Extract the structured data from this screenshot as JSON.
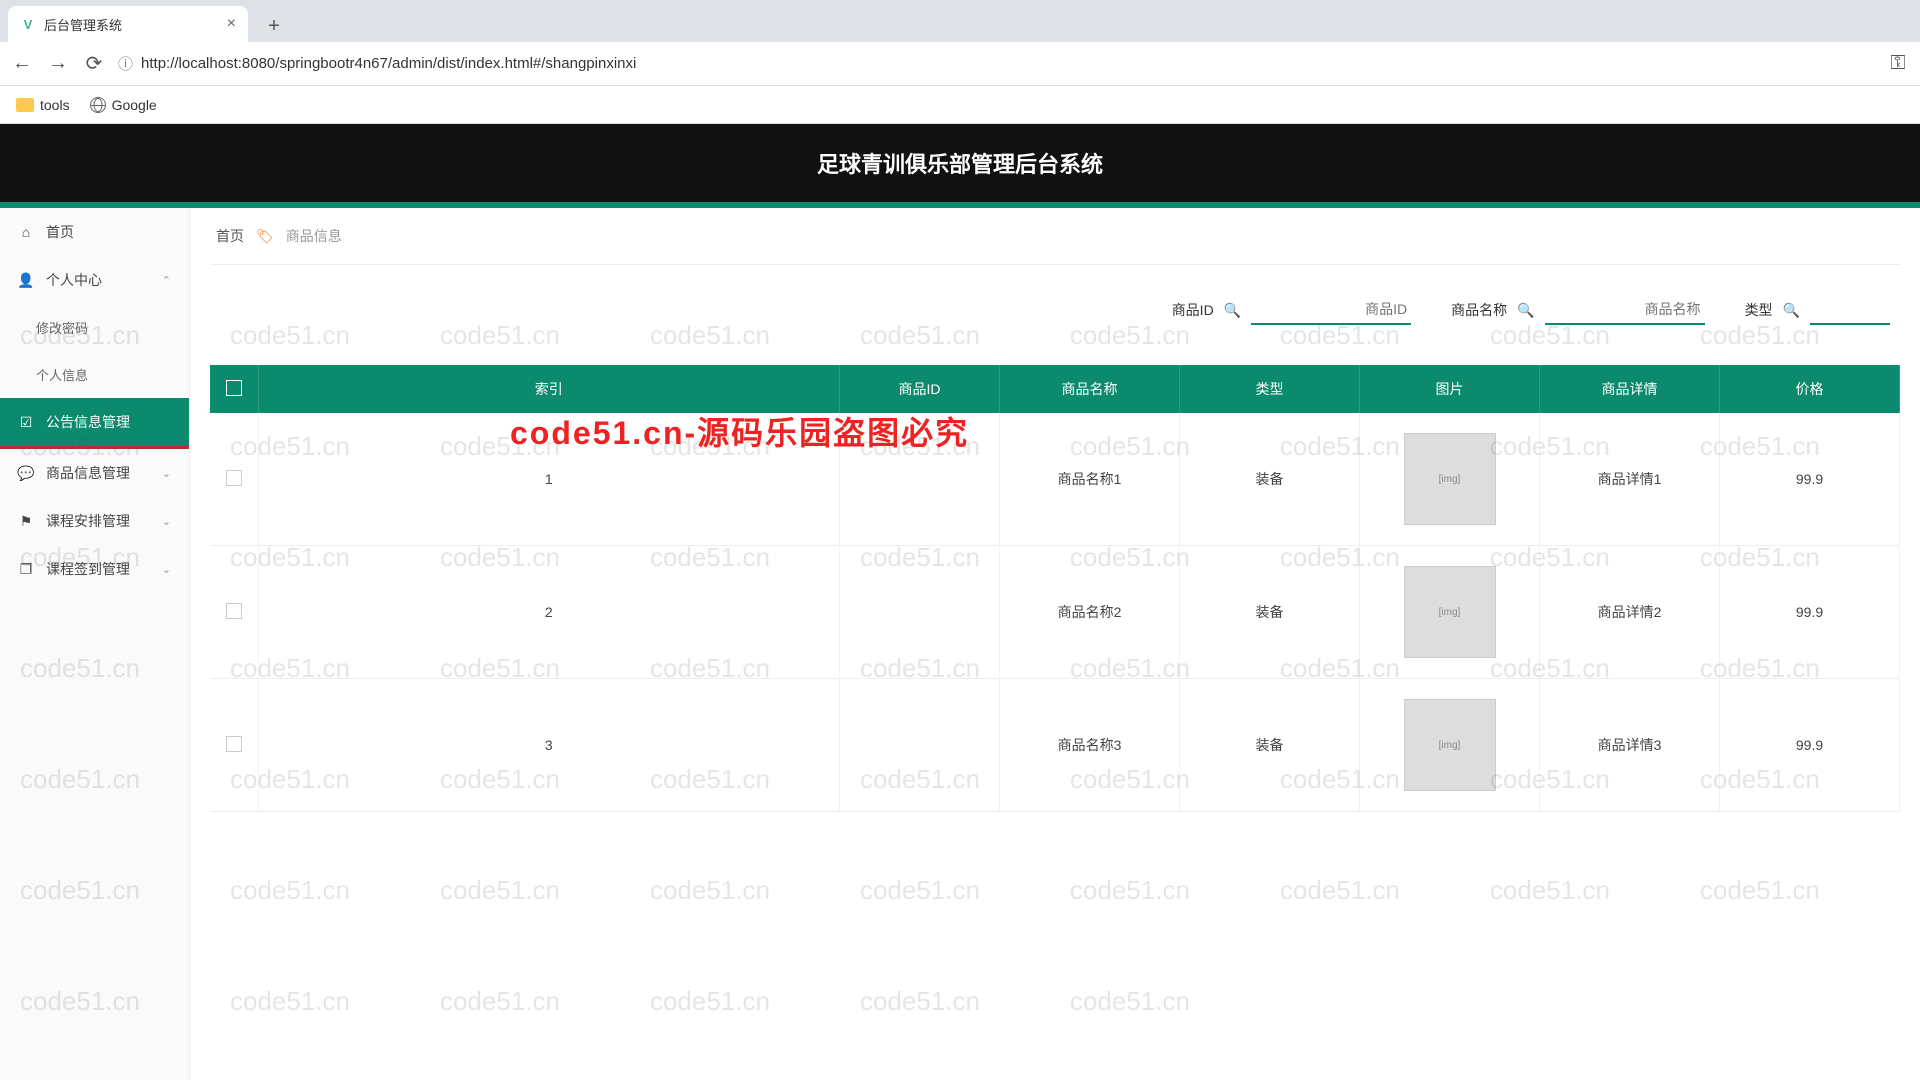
{
  "browser": {
    "tab_title": "后台管理系统",
    "new_tab": "+",
    "close_tab": "×",
    "url": "http://localhost:8080/springbootr4n67/admin/dist/index.html#/shangpinxinxi",
    "bookmarks": {
      "tools": "tools",
      "google": "Google"
    }
  },
  "app": {
    "title": "足球青训俱乐部管理后台系统"
  },
  "sidebar": {
    "home": "首页",
    "personal": "个人中心",
    "change_pw": "修改密码",
    "profile": "个人信息",
    "announce": "公告信息管理",
    "goods": "商品信息管理",
    "schedule": "课程安排管理",
    "signin": "课程签到管理"
  },
  "breadcrumb": {
    "home": "首页",
    "current": "商品信息"
  },
  "filters": {
    "id_label": "商品ID",
    "id_ph": "商品ID",
    "name_label": "商品名称",
    "name_ph": "商品名称",
    "type_label": "类型"
  },
  "columns": {
    "check": "",
    "index": "索引",
    "id": "商品ID",
    "name": "商品名称",
    "type": "类型",
    "image": "图片",
    "detail": "商品详情",
    "price": "价格"
  },
  "rows": [
    {
      "index": "1",
      "id": "",
      "name": "商品名称1",
      "type": "装备",
      "image": "[img]",
      "detail": "商品详情1",
      "price": "99.9"
    },
    {
      "index": "2",
      "id": "",
      "name": "商品名称2",
      "type": "装备",
      "image": "[img]",
      "detail": "商品详情2",
      "price": "99.9"
    },
    {
      "index": "3",
      "id": "",
      "name": "商品名称3",
      "type": "装备",
      "image": "[img]",
      "detail": "商品详情3",
      "price": "99.9"
    }
  ],
  "watermark": {
    "text": "code51.cn",
    "red": "code51.cn-源码乐园盗图必究"
  }
}
